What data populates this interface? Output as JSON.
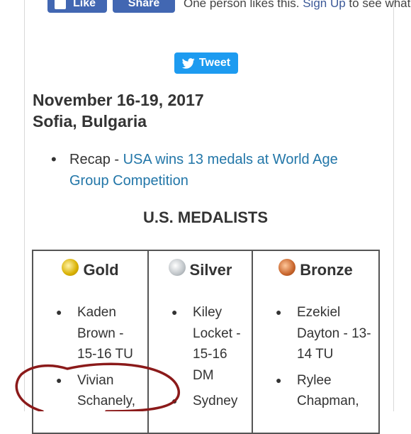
{
  "facebook": {
    "like_label": "Like",
    "share_label": "Share",
    "like_text_prefix": "One person likes this.",
    "signup_link": "Sign Up",
    "like_text_suffix": "to see what yo"
  },
  "tweet": {
    "label": "Tweet",
    "icon": "twitter-bird-icon"
  },
  "event": {
    "dates": "November 16-19, 2017",
    "location": "Sofia, Bulgaria"
  },
  "recap": {
    "prefix": "Recap -",
    "link_text": "USA wins 13 medals at World Age Group Competition"
  },
  "medalists": {
    "title": "U.S. MEDALISTS",
    "columns": [
      {
        "label": "Gold",
        "color": "#d8b000",
        "entries": [
          "Kaden Brown - 15-16 TU",
          "Vivian Schanely,"
        ]
      },
      {
        "label": "Silver",
        "color": "#bfc4c8",
        "entries": [
          "Kiley Locket - 15-16 DM",
          "Sydney"
        ]
      },
      {
        "label": "Bronze",
        "color": "#c8652c",
        "entries": [
          "Ezekiel Dayton - 13-14 TU",
          "Rylee Chapman,"
        ]
      }
    ]
  },
  "colors": {
    "facebook_blue": "#4267b2",
    "tweet_blue": "#1d9bf0",
    "link_blue": "#2276a8",
    "annotation_red": "#8b1a1a"
  }
}
